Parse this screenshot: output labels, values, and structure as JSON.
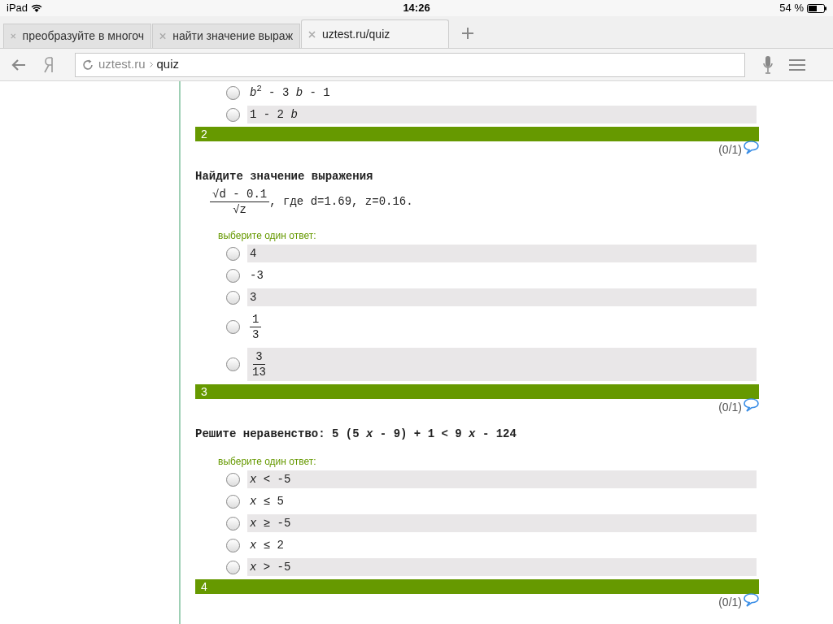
{
  "status_bar": {
    "device": "iPad",
    "time": "14:26",
    "battery": "54 %"
  },
  "tabs": [
    {
      "title": "преобразуйте в многоч",
      "selected": false
    },
    {
      "title": "найти значение выраж",
      "selected": false
    },
    {
      "title": "uztest.ru/quiz",
      "selected": true
    }
  ],
  "address_bar": {
    "domain": "uztest.ru",
    "path": "quiz"
  },
  "previous_answers": [
    {
      "kind": "text",
      "text": "*b*$^{2}$ - 3 *b* - 1",
      "selected": false
    },
    {
      "kind": "text",
      "text": "1 - 2 *b*",
      "selected": false
    }
  ],
  "questions": [
    {
      "number": "2",
      "score": "(0/1)",
      "prompt": "Найдите значение выражения",
      "formula": {
        "numerator": "√d - 0.1",
        "denominator": "√z",
        "condition": ", где d=1.69, z=0.16."
      },
      "hint": "выберите один ответ:",
      "answers": [
        {
          "kind": "text",
          "text": "4",
          "selected": false
        },
        {
          "kind": "text",
          "text": "-3",
          "selected": false
        },
        {
          "kind": "text",
          "text": "3",
          "selected": false
        },
        {
          "kind": "fraction",
          "numerator": "1",
          "denominator": "3",
          "selected": false
        },
        {
          "kind": "fraction",
          "numerator": "3",
          "denominator": "13",
          "selected": false
        }
      ]
    },
    {
      "number": "3",
      "score": "(0/1)",
      "prompt": "Решите неравенство: 5 (5 *x* - 9) + 1 < 9 *x* - 124",
      "hint": "выберите один ответ:",
      "answers": [
        {
          "kind": "text",
          "text": "*x* < -5",
          "selected": false
        },
        {
          "kind": "text",
          "text": "*x* ≤ 5",
          "selected": false
        },
        {
          "kind": "text",
          "text": "*x* ≥ -5",
          "selected": false
        },
        {
          "kind": "text",
          "text": "*x* ≤ 2",
          "selected": false
        },
        {
          "kind": "text",
          "text": "*x* > -5",
          "selected": false
        }
      ]
    },
    {
      "number": "4",
      "score": "(0/1)"
    }
  ]
}
